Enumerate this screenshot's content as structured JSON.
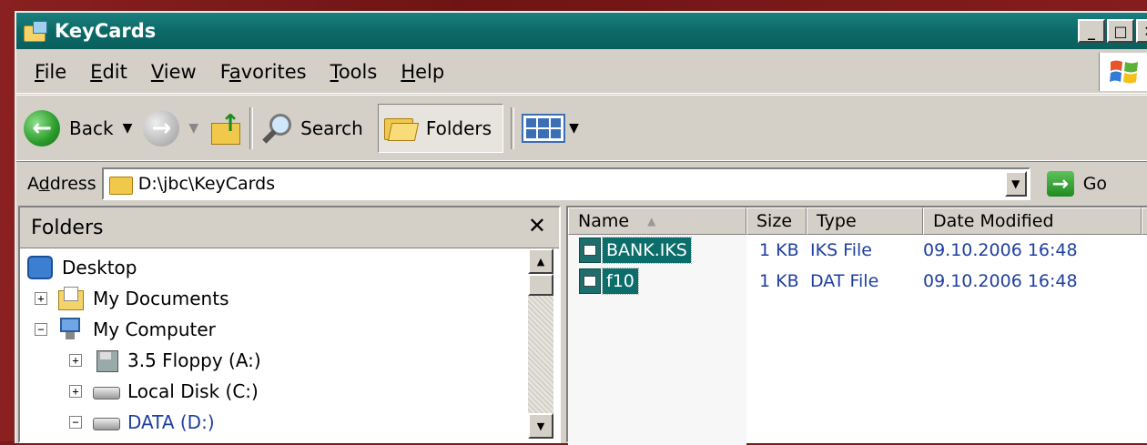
{
  "window": {
    "title": "KeyCards",
    "controls": [
      "_",
      "□",
      "✕"
    ]
  },
  "menu": [
    {
      "label": "File",
      "key": "F",
      "rest": "ile"
    },
    {
      "label": "Edit",
      "key": "E",
      "rest": "dit"
    },
    {
      "label": "View",
      "key": "V",
      "rest": "iew"
    },
    {
      "label": "Favorites",
      "pre": "F",
      "key": "a",
      "rest": "vorites"
    },
    {
      "label": "Tools",
      "key": "T",
      "rest": "ools"
    },
    {
      "label": "Help",
      "key": "H",
      "rest": "elp"
    }
  ],
  "toolbar": {
    "back_label": "Back",
    "search_label": "Search",
    "folders_label": "Folders"
  },
  "address": {
    "label_pre": "A",
    "label_key": "d",
    "label_rest": "dress",
    "value": "D:\\jbc\\KeyCards",
    "go_label": "Go"
  },
  "folders_pane": {
    "title": "Folders",
    "close": "✕",
    "tree": [
      {
        "label": "Desktop",
        "icon": "desktop-icon",
        "expander": ""
      },
      {
        "label": "My Documents",
        "icon": "my-documents-icon",
        "expander": "+"
      },
      {
        "label": "My Computer",
        "icon": "my-computer-icon",
        "expander": "−"
      },
      {
        "label": "3.5 Floppy (A:)",
        "icon": "floppy-drive-icon",
        "expander": "+"
      },
      {
        "label": "Local Disk (C:)",
        "icon": "hard-disk-icon",
        "expander": "+"
      },
      {
        "label": "DATA (D:)",
        "icon": "hard-disk-icon",
        "expander": "−",
        "selected": true
      }
    ]
  },
  "file_list": {
    "columns": [
      "Name",
      "Size",
      "Type",
      "Date Modified"
    ],
    "sort_indicator": "▲",
    "rows": [
      {
        "name": "BANK.IKS",
        "size": "1 KB",
        "type": "IKS File",
        "modified": "09.10.2006 16:48"
      },
      {
        "name": "f10",
        "size": "1 KB",
        "type": "DAT File",
        "modified": "09.10.2006 16:48"
      }
    ]
  },
  "colors": {
    "titlebar": "#0b6a68",
    "selection": "#0c6e6b",
    "link_text": "#1f3fa0",
    "chrome": "#d4d0c8"
  }
}
